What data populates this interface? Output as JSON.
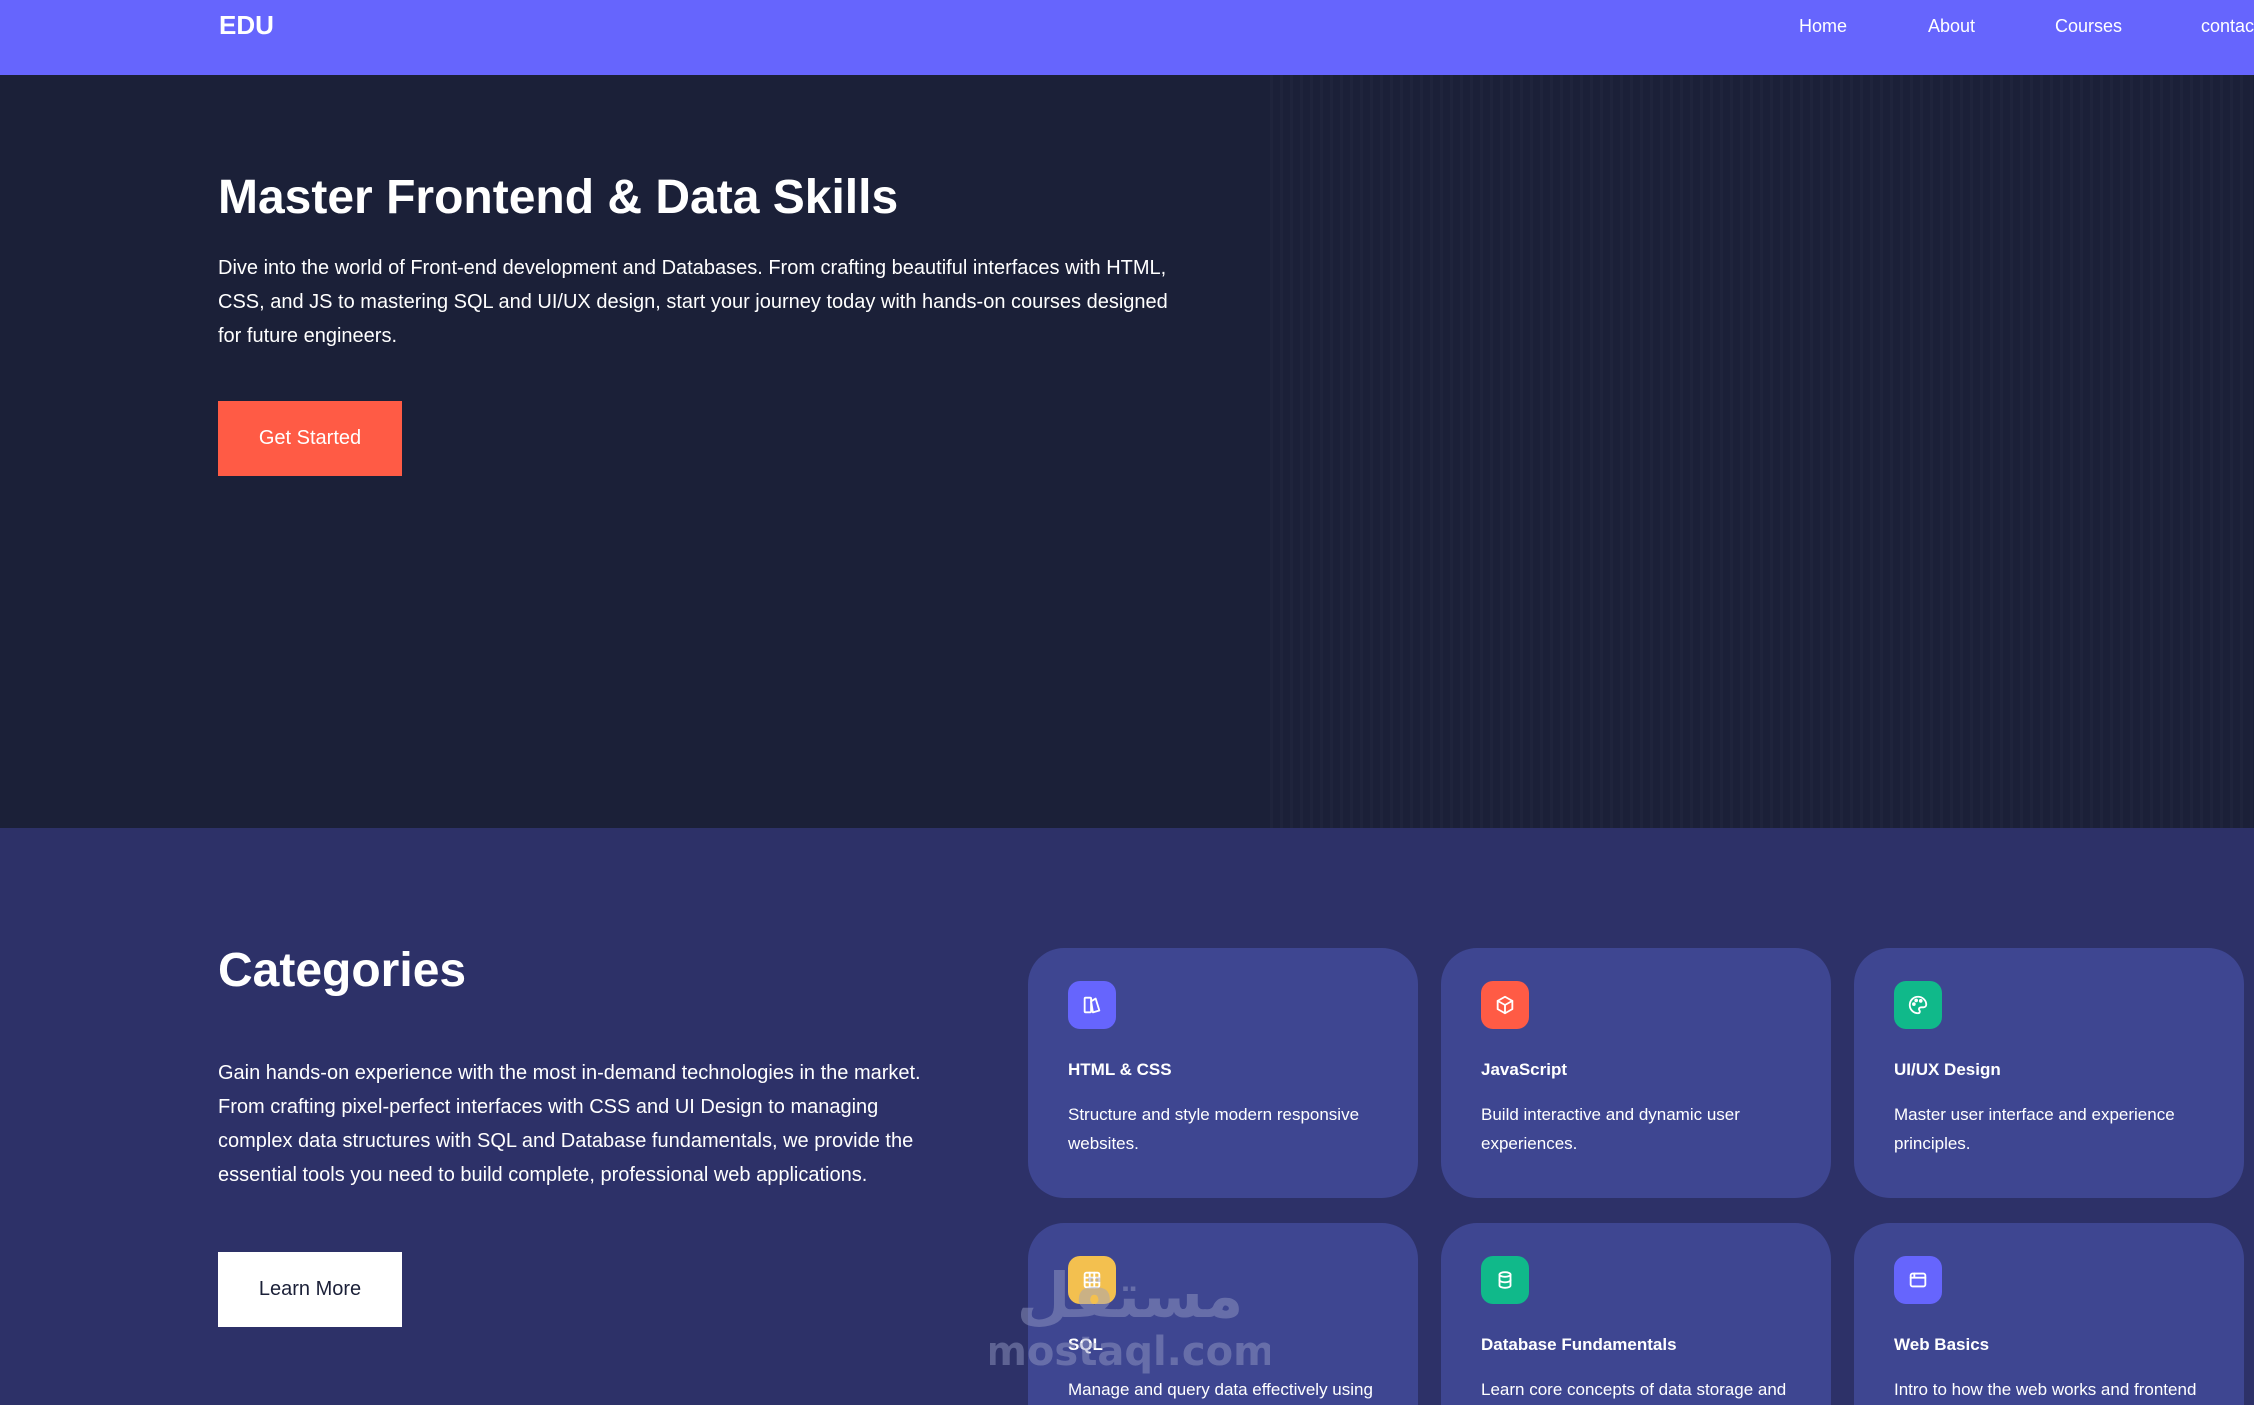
{
  "navbar": {
    "logo": "EDU",
    "links": [
      "Home",
      "About",
      "Courses",
      "contact"
    ]
  },
  "hero": {
    "title": "Master Frontend & Data Skills",
    "description": "Dive into the world of Front-end development and Databases. From crafting beautiful interfaces with HTML, CSS, and JS to mastering SQL and UI/UX design, start your journey today with hands-on courses designed for future engineers.",
    "button": "Get Started"
  },
  "categories": {
    "title": "Categories",
    "description": "Gain hands-on experience with the most in-demand technologies in the market. From crafting pixel-perfect interfaces with CSS and UI Design to managing complex data structures with SQL and Database fundamentals, we provide the essential tools you need to build complete, professional web applications.",
    "button": "Learn More",
    "cards": [
      {
        "title": "HTML & CSS",
        "description": "Structure and style modern responsive websites.",
        "icon": "palette-book-icon",
        "color": "#6665fd"
      },
      {
        "title": "JavaScript",
        "description": "Build interactive and dynamic user experiences.",
        "icon": "cube-icon",
        "color": "#ff5b45"
      },
      {
        "title": "UI/UX Design",
        "description": "Master user interface and experience principles.",
        "icon": "palette-icon",
        "color": "#10b98a"
      },
      {
        "title": "SQL",
        "description": "Manage and query data effectively using",
        "icon": "grid-table-icon",
        "color": "#f3c04f"
      },
      {
        "title": "Database Fundamentals",
        "description": "Learn core concepts of data storage and",
        "icon": "database-icon",
        "color": "#10b98a"
      },
      {
        "title": "Web Basics",
        "description": "Intro to how the web works and frontend",
        "icon": "browser-window-icon",
        "color": "#6665fd"
      }
    ]
  },
  "watermark": {
    "arabic": "مستقل",
    "latin": "mostaql.com"
  }
}
